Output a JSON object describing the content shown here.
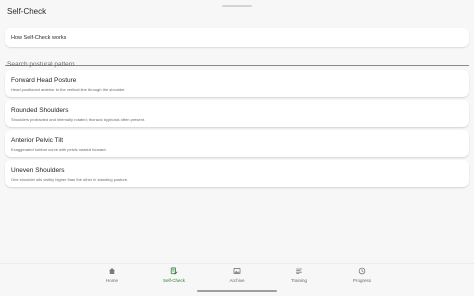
{
  "app": {
    "title": "Self-Check"
  },
  "info": {
    "label": "How Self-Check works"
  },
  "search": {
    "placeholder": "Search postural pattern"
  },
  "patterns": [
    {
      "title": "Forward Head Posture",
      "description": "Head positioned anterior to the vertical line through the shoulder."
    },
    {
      "title": "Rounded Shoulders",
      "description": "Shoulders protracted and internally rotated; thoracic kyphosis often present."
    },
    {
      "title": "Anterior Pelvic Tilt",
      "description": "Exaggerated lumbar curve with pelvis rotated forward."
    },
    {
      "title": "Uneven Shoulders",
      "description": "One shoulder sits visibly higher than the other in standing posture."
    }
  ],
  "nav": {
    "items": [
      {
        "label": "Home",
        "icon": "home-icon"
      },
      {
        "label": "Self-Check",
        "icon": "self-check-icon",
        "active": true
      },
      {
        "label": "Archive",
        "icon": "archive-icon"
      },
      {
        "label": "Training",
        "icon": "training-icon"
      },
      {
        "label": "Progress",
        "icon": "progress-icon"
      }
    ]
  },
  "colors": {
    "accent": "#2e7d32",
    "background": "#f7f7f7",
    "card": "#ffffff"
  }
}
